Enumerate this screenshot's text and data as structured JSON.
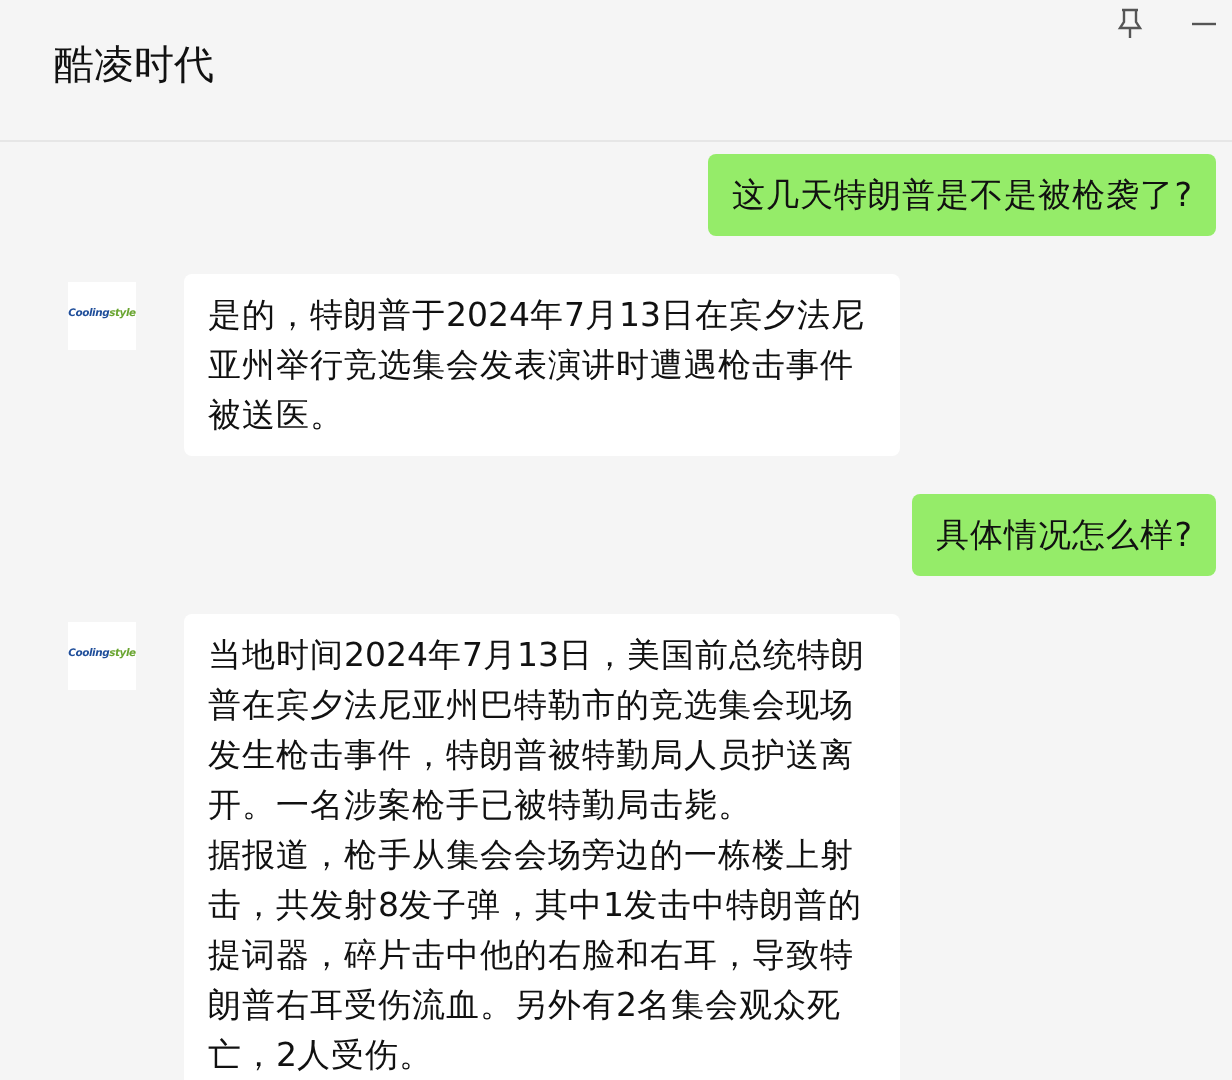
{
  "window": {
    "title": "酷凌时代"
  },
  "messages": [
    {
      "kind": "sent",
      "paragraphs": [
        "这几天特朗普是不是被枪袭了?"
      ]
    },
    {
      "kind": "received",
      "avatar": {
        "logo": [
          "Cooling",
          "style"
        ]
      },
      "paragraphs": [
        "是的，特朗普于2024年7月13日在宾夕法尼亚州举行竞选集会发表演讲时遭遇枪击事件被送医。"
      ]
    },
    {
      "kind": "sent",
      "paragraphs": [
        "具体情况怎么样?"
      ]
    },
    {
      "kind": "received",
      "avatar": {
        "logo": [
          "Cooling",
          "style"
        ]
      },
      "paragraphs": [
        "当地时间2024年7月13日，美国前总统特朗普在宾夕法尼亚州巴特勒市的竞选集会现场发生枪击事件，特朗普被特勤局人员护送离开。一名涉案枪手已被特勤局击毙。",
        "据报道，枪手从集会会场旁边的一栋楼上射击，共发射8发子弹，其中1发击中特朗普的提词器，碎片击中他的右脸和右耳，导致特朗普右耳受伤流血。另外有2名集会观众死亡，2人受伤。"
      ]
    }
  ]
}
